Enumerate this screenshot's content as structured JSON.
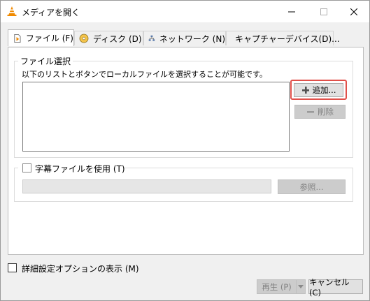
{
  "window": {
    "title": "メディアを開く"
  },
  "tabs": [
    {
      "label": "ファイル (F)",
      "icon": "file-icon"
    },
    {
      "label": "ディスク (D)",
      "icon": "disc-icon"
    },
    {
      "label": "ネットワーク (N)",
      "icon": "network-icon"
    },
    {
      "label": "キャプチャーデバイス(D)...",
      "icon": "capture-device-icon"
    }
  ],
  "file_selection": {
    "group_title": "ファイル選択",
    "description": "以下のリストとボタンでローカルファイルを選択することが可能です。",
    "add_label": "追加...",
    "remove_label": "削除"
  },
  "subtitles": {
    "checkbox_label": "字幕ファイルを使用 (T)",
    "browse_label": "参照..."
  },
  "advanced": {
    "checkbox_label": "詳細設定オプションの表示 (M)"
  },
  "footer": {
    "play_label": "再生 (P)",
    "cancel_label": "キャンセル (C)"
  },
  "colors": {
    "highlight": "#e0504a",
    "vlc_orange": "#f08a00"
  }
}
